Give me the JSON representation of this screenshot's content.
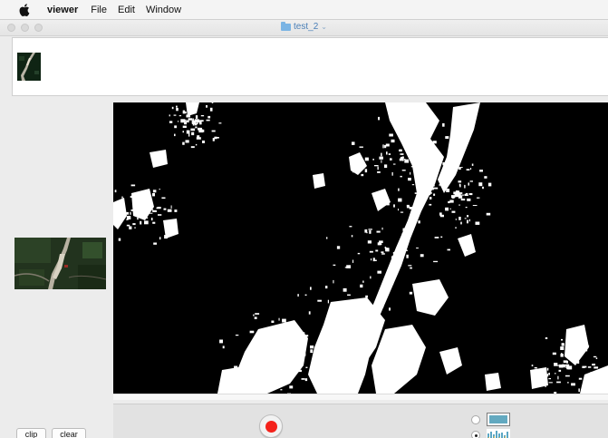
{
  "menubar": {
    "apple_icon": "apple-icon",
    "app_name": "viewer",
    "items": [
      "File",
      "Edit",
      "Window"
    ]
  },
  "window": {
    "title": "test_2",
    "title_icon": "folder-icon",
    "title_color": "#4a7fb7"
  },
  "thumbnail_strip": {
    "items": [
      "thumbnail"
    ]
  },
  "controls": {
    "record_icon": "record-icon",
    "record_color": "#f4221b",
    "radio_options": [
      {
        "selected": false,
        "icon": "colormap-swatch-icon"
      },
      {
        "selected": true,
        "icon": "histogram-swatch-icon"
      }
    ],
    "swatch_color": "#63a9c0"
  },
  "buttons": {
    "clip_label": "clip",
    "clear_label": "clear"
  }
}
